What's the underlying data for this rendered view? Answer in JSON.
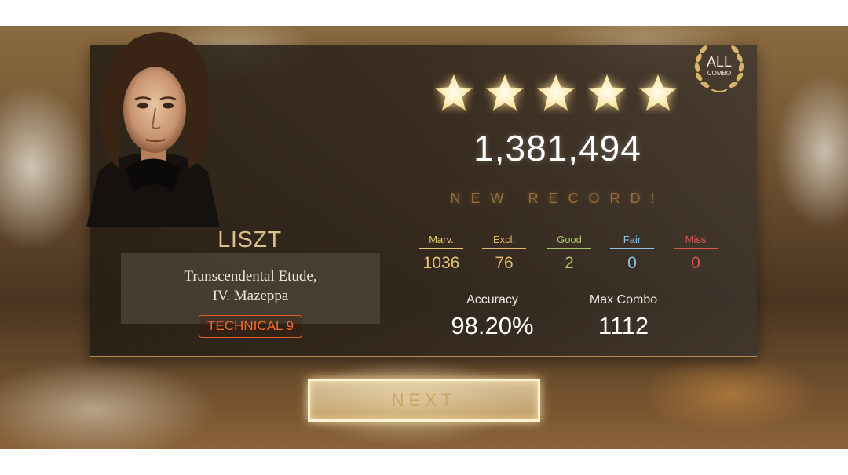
{
  "composer": "LISZT",
  "song": {
    "title_line1": "Transcendental Etude,",
    "title_line2": "IV. Mazeppa"
  },
  "difficulty": "TECHNICAL 9",
  "stars": {
    "earned": 5,
    "total": 5
  },
  "score": "1,381,494",
  "record_label": "NEW RECORD!",
  "badge": {
    "line1": "ALL",
    "line2": "COMBO"
  },
  "judgements": [
    {
      "label": "Marv.",
      "value": "1036",
      "color": "#e8c678"
    },
    {
      "label": "Excl.",
      "value": "76",
      "color": "#e5b56a"
    },
    {
      "label": "Good",
      "value": "2",
      "color": "#a9c46c"
    },
    {
      "label": "Fair",
      "value": "0",
      "color": "#8fc4e6"
    },
    {
      "label": "Miss",
      "value": "0",
      "color": "#e0574a"
    }
  ],
  "accuracy": {
    "label": "Accuracy",
    "value": "98.20%"
  },
  "max_combo": {
    "label": "Max Combo",
    "value": "1112"
  },
  "next_label": "NEXT"
}
